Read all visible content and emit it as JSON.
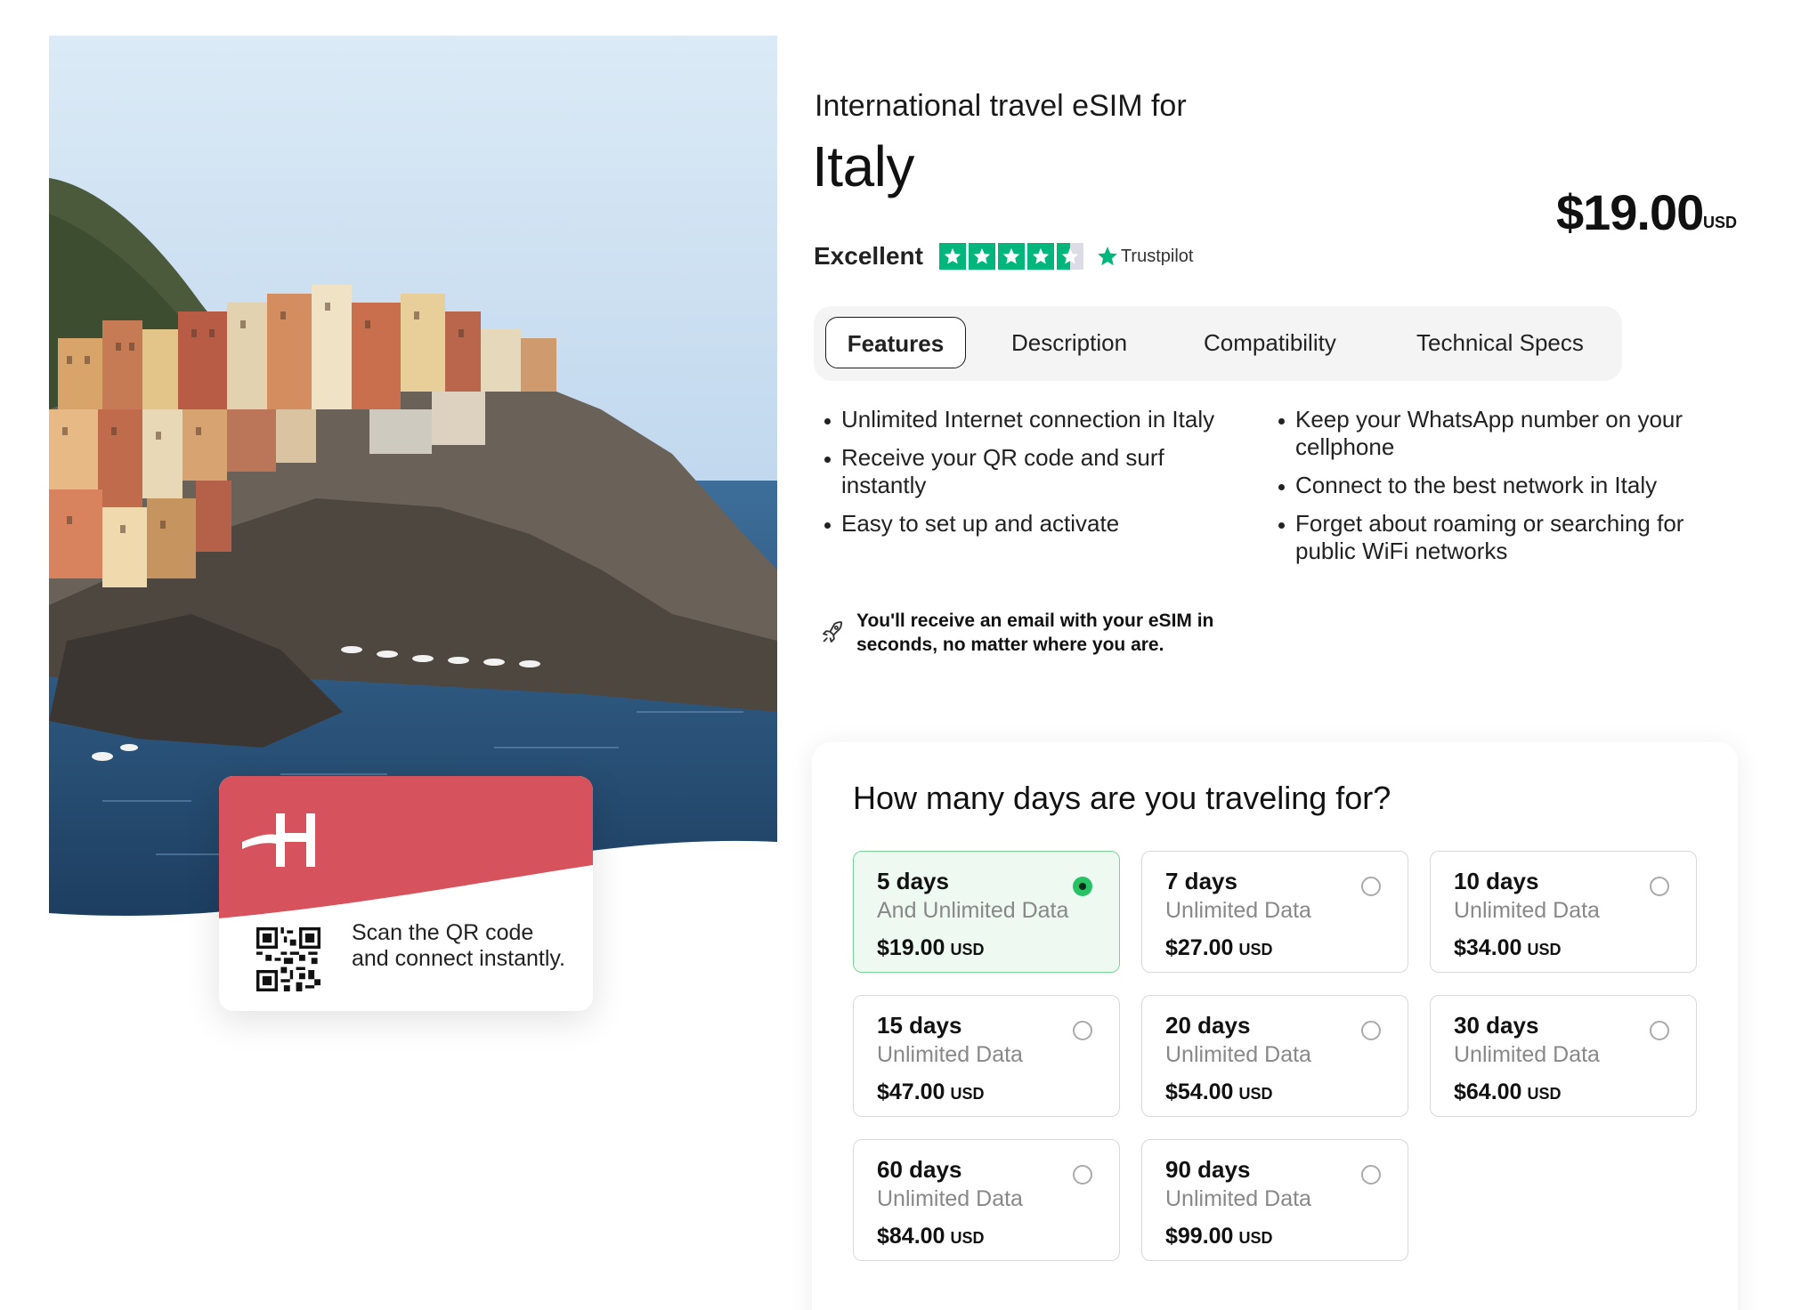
{
  "product": {
    "subtitle": "International travel eSIM for",
    "country": "Italy",
    "price": "$19.00",
    "currency": "USD"
  },
  "rating": {
    "label": "Excellent",
    "stars": 4.5,
    "provider": "Trustpilot",
    "color": "#00b67a"
  },
  "tabs": [
    {
      "label": "Features",
      "active": true
    },
    {
      "label": "Description",
      "active": false
    },
    {
      "label": "Compatibility",
      "active": false
    },
    {
      "label": "Technical Specs",
      "active": false
    }
  ],
  "features": {
    "col1": [
      "Unlimited Internet connection in Italy",
      "Receive your QR code and surf instantly",
      "Easy to set up and activate"
    ],
    "col2": [
      "Keep your WhatsApp number on your cellphone",
      "Connect to the best network in Italy",
      "Forget about roaming or searching for public WiFi networks"
    ]
  },
  "notice": {
    "icon": "rocket-icon",
    "text": "You'll receive an email with your eSIM in seconds, no matter where you are."
  },
  "esim_card": {
    "logo": "H",
    "scan_text": "Scan the QR code and connect instantly.",
    "accent": "#d6525c"
  },
  "plans": {
    "title": "How many days are you traveling for?",
    "selected_color": "#27c263",
    "items": [
      {
        "days": "5 days",
        "data": "And Unlimited Data",
        "price": "$19.00",
        "currency": "USD",
        "selected": true
      },
      {
        "days": "7 days",
        "data": "Unlimited Data",
        "price": "$27.00",
        "currency": "USD",
        "selected": false
      },
      {
        "days": "10 days",
        "data": "Unlimited Data",
        "price": "$34.00",
        "currency": "USD",
        "selected": false
      },
      {
        "days": "15 days",
        "data": "Unlimited Data",
        "price": "$47.00",
        "currency": "USD",
        "selected": false
      },
      {
        "days": "20 days",
        "data": "Unlimited Data",
        "price": "$54.00",
        "currency": "USD",
        "selected": false
      },
      {
        "days": "30 days",
        "data": "Unlimited Data",
        "price": "$64.00",
        "currency": "USD",
        "selected": false
      },
      {
        "days": "60 days",
        "data": "Unlimited Data",
        "price": "$84.00",
        "currency": "USD",
        "selected": false
      },
      {
        "days": "90 days",
        "data": "Unlimited Data",
        "price": "$99.00",
        "currency": "USD",
        "selected": false
      }
    ]
  }
}
